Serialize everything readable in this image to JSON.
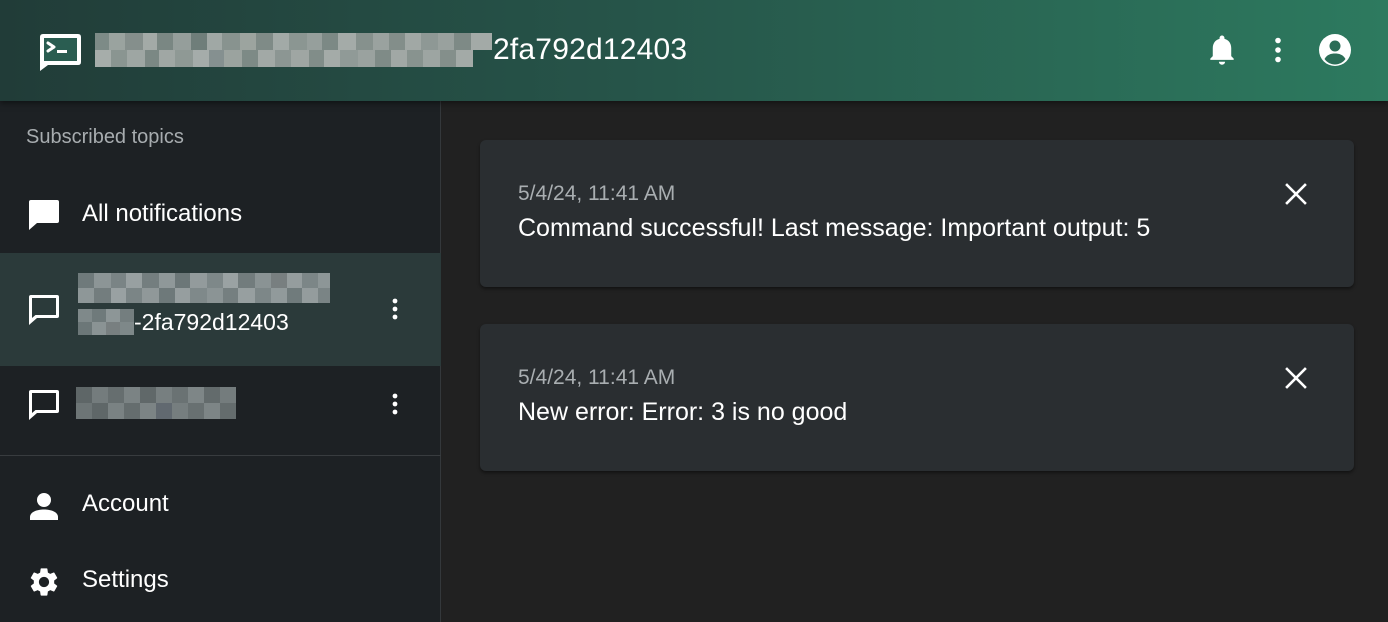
{
  "header": {
    "title_suffix": "2fa792d12403",
    "app_icon": "terminal-chat-icon",
    "actions": [
      "bell-icon",
      "more-vert-icon",
      "account-circle-icon"
    ]
  },
  "sidebar": {
    "section_title": "Subscribed topics",
    "all_notifications_label": "All notifications",
    "topics": [
      {
        "label_suffix": "-2fa792d12403",
        "selected": true
      },
      {
        "label_suffix": "",
        "selected": false
      }
    ],
    "account_label": "Account",
    "settings_label": "Settings"
  },
  "notifications": [
    {
      "time": "5/4/24, 11:41 AM",
      "message": "Command successful! Last message: Important output: 5"
    },
    {
      "time": "5/4/24, 11:41 AM",
      "message": "New error: Error: 3 is no good"
    }
  ],
  "colors": {
    "appbar_start": "#213c38",
    "appbar_end": "#2d7a5f",
    "drawer_bg": "#1d2124",
    "selected_topic_bg": "#2b3a3a",
    "card_bg": "#2a2e31",
    "main_bg": "#212121"
  }
}
